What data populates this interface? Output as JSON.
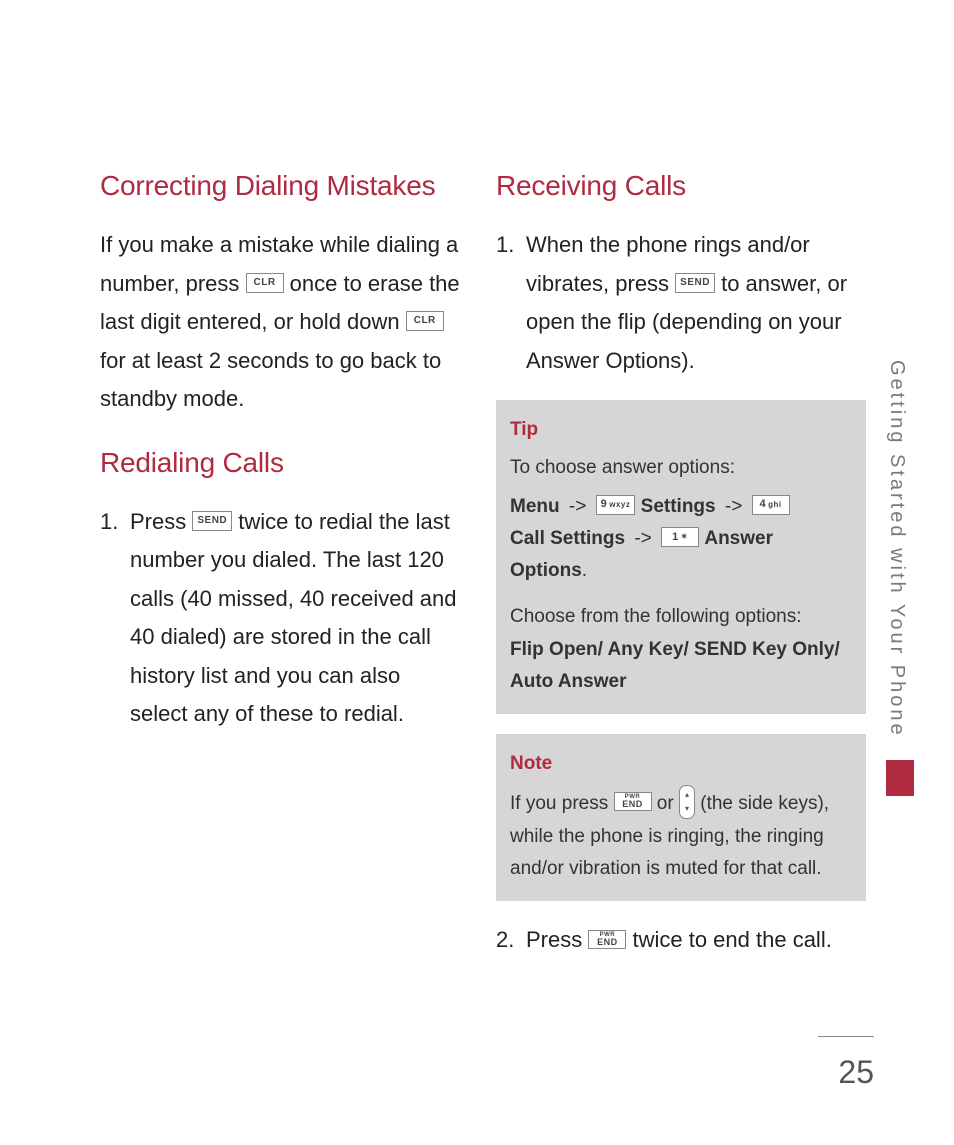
{
  "section_tab": "Getting Started with Your Phone",
  "page_number": "25",
  "keys": {
    "clr": "CLR",
    "send": "SEND",
    "end_sup": "PWR",
    "end_main": "END",
    "d9": "9",
    "d9_sub": "wxyz",
    "d4": "4",
    "d4_sub": "ghi",
    "d1": "1",
    "d1_sub": "✶"
  },
  "left": {
    "h_correcting": "Correcting Dialing Mistakes",
    "p1_a": "If you make a mistake while dialing a number, press ",
    "p1_b": " once to erase the last digit entered, or hold down ",
    "p1_c": " for at least 2 seconds to go back to standby mode.",
    "h_redial": "Redialing Calls",
    "redial_num": "1.",
    "redial_a": "Press ",
    "redial_b": " twice to redial the last number you dialed. The last 120 calls (40 missed, 40 received and 40 dialed) are stored in the call history list and you can also select any of these to redial."
  },
  "right": {
    "h_receiving": "Receiving Calls",
    "recv_num": "1.",
    "recv_a": "When the phone rings and/or vibrates, press ",
    "recv_b": " to answer, or open the flip (depending on your Answer Options).",
    "tip": {
      "title": "Tip",
      "line1": "To choose answer options:",
      "seq_menu": "Menu",
      "arrow": "->",
      "seq_settings": "Settings",
      "seq_call": "Call Settings",
      "seq_answer": "Answer Options",
      "period": ".",
      "line3": "Choose from the following options:",
      "options": "Flip Open/ Any Key/ SEND Key Only/ Auto Answer"
    },
    "note": {
      "title": "Note",
      "a": "If you press ",
      "or": " or ",
      "b": " (the side keys), while the phone is ringing, the ringing and/or vibration is muted for that call."
    },
    "step2_num": "2.",
    "step2_a": "Press ",
    "step2_b": " twice to end the call."
  }
}
